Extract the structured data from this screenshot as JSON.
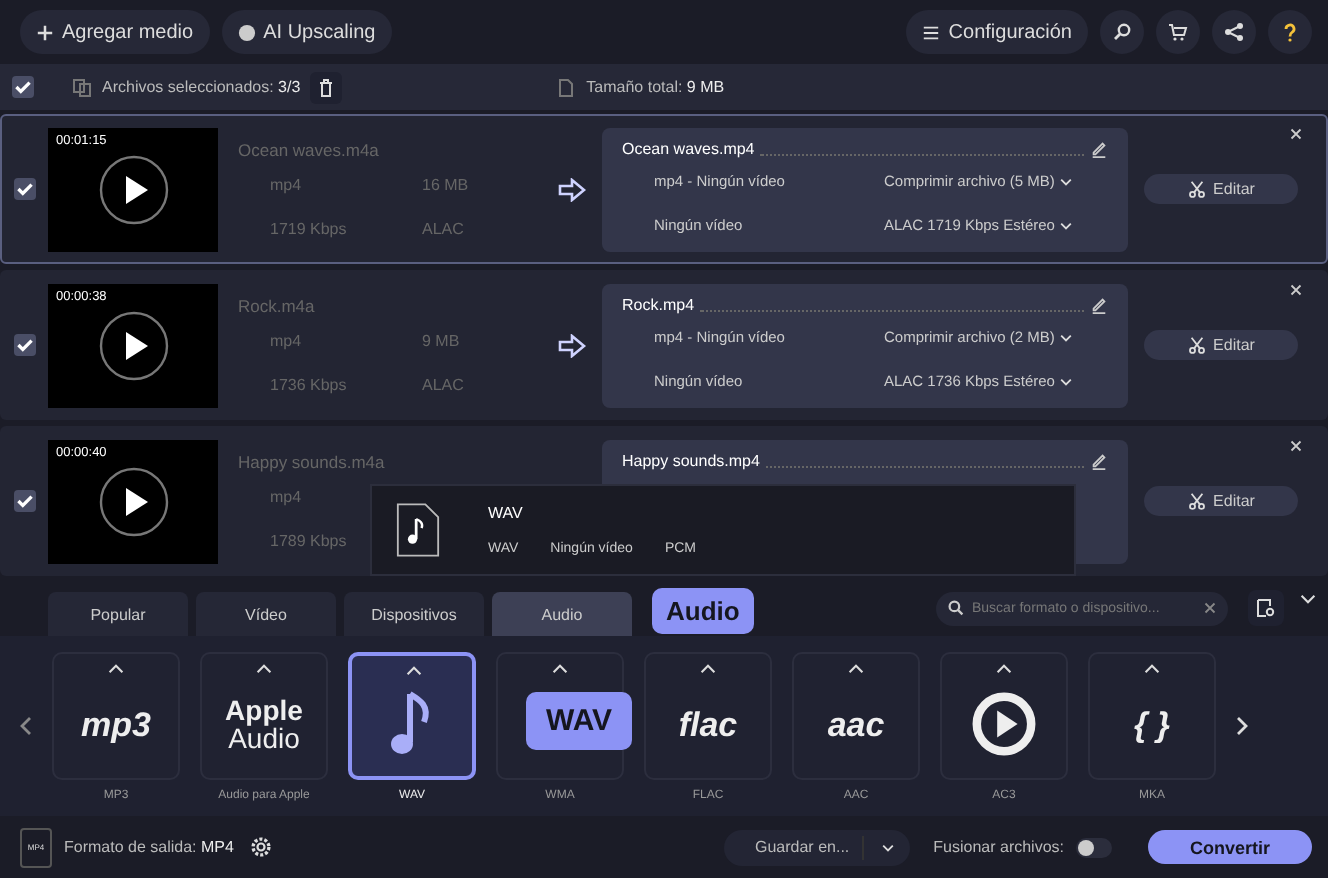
{
  "toolbar": {
    "add_media": "Agregar medio",
    "ai_upscaling": "AI Upscaling",
    "settings": "Configuración"
  },
  "selection_bar": {
    "checked": true,
    "selected_label": "Archivos seleccionados:",
    "selected_count": "3/3",
    "total_label": "Tamaño total:",
    "total_value": "9 MB"
  },
  "files": [
    {
      "checked": true,
      "selected": true,
      "duration": "00:01:15",
      "source_name": "Ocean waves.m4a",
      "container": "mp4",
      "size": "16 MB",
      "bitrate": "1719 Kbps",
      "codec": "ALAC",
      "output_name": "Ocean waves.mp4",
      "output_format": "mp4 - Ningún vídeo",
      "compress": "Comprimir archivo (5 MB)",
      "video": "Ningún vídeo",
      "audio": "ALAC 1719 Kbps Estéreo",
      "edit": "Editar"
    },
    {
      "checked": true,
      "selected": false,
      "duration": "00:00:38",
      "source_name": "Rock.m4a",
      "container": "mp4",
      "size": "9 MB",
      "bitrate": "1736 Kbps",
      "codec": "ALAC",
      "output_name": "Rock.mp4",
      "output_format": "mp4 - Ningún vídeo",
      "compress": "Comprimir archivo (2 MB)",
      "video": "Ningún vídeo",
      "audio": "ALAC 1736 Kbps Estéreo",
      "edit": "Editar"
    },
    {
      "checked": true,
      "selected": false,
      "duration": "00:00:40",
      "source_name": "Happy sounds.m4a",
      "container": "mp4",
      "bitrate": "1789 Kbps",
      "output_name": "Happy sounds.mp4",
      "edit": "Editar"
    }
  ],
  "format_popup": {
    "title": "WAV",
    "details": [
      "WAV",
      "Ningún vídeo",
      "PCM"
    ]
  },
  "tabs": [
    {
      "label": "Popular",
      "selected": false
    },
    {
      "label": "Vídeo",
      "selected": false
    },
    {
      "label": "Dispositivos",
      "selected": false
    },
    {
      "label": "Audio",
      "selected": true
    }
  ],
  "tab_callout": "Audio",
  "search": {
    "placeholder": "Buscar formato o dispositivo..."
  },
  "formats": [
    {
      "kind": "text",
      "logo": [
        "mp3"
      ],
      "label": "MP3",
      "selected": false
    },
    {
      "kind": "text",
      "logo": [
        "Apple",
        "Audio"
      ],
      "label": "Audio para Apple",
      "selected": false
    },
    {
      "kind": "note",
      "label": "WAV",
      "selected": true
    },
    {
      "kind": "blank",
      "label": "WMA",
      "selected": false
    },
    {
      "kind": "text",
      "logo": [
        "flac"
      ],
      "label": "FLAC",
      "selected": false
    },
    {
      "kind": "text",
      "logo": [
        "aac"
      ],
      "label": "AAC",
      "selected": false
    },
    {
      "kind": "play",
      "label": "AC3",
      "selected": false
    },
    {
      "kind": "text",
      "logo": [
        "{ }"
      ],
      "label": "MKA",
      "selected": false
    }
  ],
  "format_callout": "WAV",
  "bottom_bar": {
    "file_badge": "MP4",
    "output_label": "Formato de salida:",
    "output_value": "MP4",
    "save_to": "Guardar en...",
    "merge_label": "Fusionar archivos:",
    "merge_on": false,
    "convert": "Convertir"
  }
}
